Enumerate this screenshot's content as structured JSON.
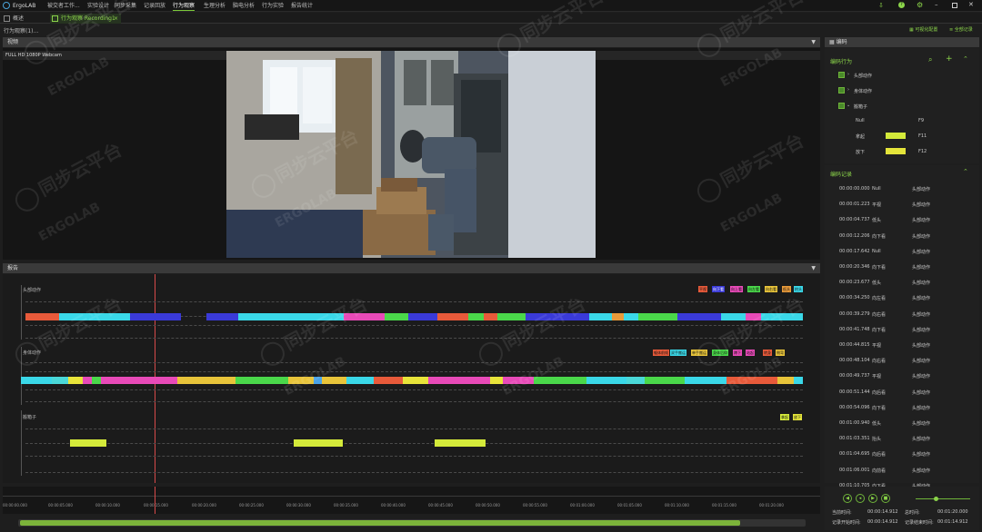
{
  "menubar": {
    "logo": "ErgoLAB",
    "items": [
      "被交者工作...",
      "实验设计",
      "同步采集",
      "记录回放",
      "行为观察",
      "生理分析",
      "脑电分析",
      "行为实验",
      "报告统计"
    ],
    "active_index": 4
  },
  "tabs": [
    {
      "label": "概述",
      "active": false
    },
    {
      "label": "行为观察 Recording1",
      "active": true
    }
  ],
  "subbar": {
    "left": "行为观察(1)...",
    "right_1": "可视化配置",
    "right_2": "全部记录"
  },
  "video_panel": {
    "title": "视频",
    "camera": "FULL HD 1080P Webcam"
  },
  "timeline_panel": {
    "title": "报告",
    "tracks": [
      {
        "name": "头部动作",
        "legend": [
          "平视",
          "向下看",
          "向上看",
          "向左看",
          "向右看",
          "低头",
          "抬头"
        ]
      },
      {
        "name": "身体动作",
        "legend": [
          "躯体前倾",
          "双手搬运",
          "单手搬运",
          "身体后仰",
          "蹲下",
          "站起",
          "转身",
          "侧弯"
        ]
      },
      {
        "name": "搬箱子",
        "legend": [
          "拿起",
          "放下"
        ]
      }
    ],
    "ticks": [
      "00:00:00.000",
      "00:00:05.000",
      "00:00:10.000",
      "00:00:15.000",
      "00:00:20.000",
      "00:00:25.000",
      "00:00:30.000",
      "00:00:35.000",
      "00:00:40.000",
      "00:00:45.000",
      "00:00:50.000",
      "00:00:55.000",
      "00:01:00.000",
      "00:01:05.000",
      "00:01:10.000",
      "00:01:15.000",
      "00:01:20.000"
    ]
  },
  "coding_panel": {
    "title": "编码",
    "behavior_header": "编码行为",
    "groups": [
      {
        "label": "头部动作",
        "expanded": false
      },
      {
        "label": "身体动作",
        "expanded": false
      },
      {
        "label": "搬箱子",
        "expanded": true
      }
    ],
    "items": [
      {
        "name": "Null",
        "key": "F9",
        "color": ""
      },
      {
        "name": "拿起",
        "key": "F11",
        "color": "#d4ea3a"
      },
      {
        "name": "放下",
        "key": "F12",
        "color": "#e4e43a"
      }
    ]
  },
  "records_panel": {
    "title": "编码记录",
    "rows": [
      {
        "time": "00:00:00.000",
        "name": "Null",
        "group": "头部动作"
      },
      {
        "time": "00:00:01.223",
        "name": "平视",
        "group": "头部动作"
      },
      {
        "time": "00:00:04.737",
        "name": "低头",
        "group": "头部动作"
      },
      {
        "time": "00:00:12.206",
        "name": "向下看",
        "group": "头部动作"
      },
      {
        "time": "00:00:17.642",
        "name": "Null",
        "group": "头部动作"
      },
      {
        "time": "00:00:20.346",
        "name": "向下看",
        "group": "头部动作"
      },
      {
        "time": "00:00:23.677",
        "name": "低头",
        "group": "头部动作"
      },
      {
        "time": "00:00:34.250",
        "name": "向左看",
        "group": "头部动作"
      },
      {
        "time": "00:00:39.279",
        "name": "向右看",
        "group": "头部动作"
      },
      {
        "time": "00:00:41.748",
        "name": "向下看",
        "group": "头部动作"
      },
      {
        "time": "00:00:44.815",
        "name": "平视",
        "group": "头部动作"
      },
      {
        "time": "00:00:48.104",
        "name": "向右看",
        "group": "头部动作"
      },
      {
        "time": "00:00:49.737",
        "name": "平视",
        "group": "头部动作"
      },
      {
        "time": "00:00:51.144",
        "name": "向后看",
        "group": "头部动作"
      },
      {
        "time": "00:00:54.096",
        "name": "向下看",
        "group": "头部动作"
      },
      {
        "time": "00:01:00.940",
        "name": "低头",
        "group": "头部动作"
      },
      {
        "time": "00:01:03.351",
        "name": "抬头",
        "group": "头部动作"
      },
      {
        "time": "00:01:04.695",
        "name": "向后看",
        "group": "头部动作"
      },
      {
        "time": "00:01:06.001",
        "name": "向前看",
        "group": "头部动作"
      },
      {
        "time": "00:01:10.705",
        "name": "向下看",
        "group": "头部动作"
      }
    ]
  },
  "playback": {
    "current_label": "当前时间:",
    "current": "00:00:14.912",
    "total_label": "总时间:",
    "total": "00:01:20.000",
    "record_label": "记录开始时间:",
    "record": "00:00:14.912",
    "end_label": "记录结束时间:",
    "end": "00:01:14.912",
    "progress": 0.92,
    "volume": 0.7
  },
  "watermark": {
    "cn": "同步云平台",
    "en": "ERGOLAB"
  },
  "colors": {
    "accent": "#8bd44a",
    "panel_header": "#3a3a3a",
    "background": "#1e1e1e"
  }
}
